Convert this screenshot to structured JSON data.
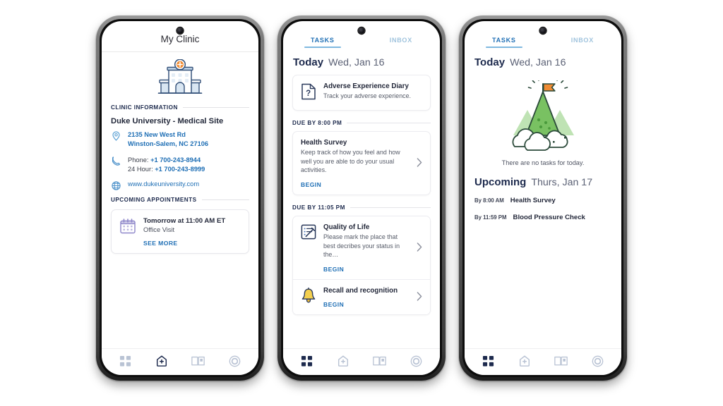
{
  "colors": {
    "brand_blue": "#1f6fb5",
    "navy": "#1d2a4d",
    "tab_inactive": "#9fc3dd",
    "accent_orange": "#e8792b",
    "green": "#6cbb5a",
    "calendar_purple": "#8d86c9",
    "bell_yellow": "#f0c83c"
  },
  "phone1": {
    "header_title": "My Clinic",
    "hospital_icon": "hospital-building-icon",
    "clinic_information_label": "CLINIC INFORMATION",
    "clinic_name": "Duke University - Medical Site",
    "address": {
      "icon": "location-pin-icon",
      "line1": "2135 New West Rd",
      "line2": "Winston-Salem, NC 27106"
    },
    "phone": {
      "icon": "phone-icon",
      "label1": "Phone: ",
      "number1": "+1 700-243-8944",
      "label2": "24 Hour: ",
      "number2": "+1 700-243-8999"
    },
    "website": {
      "icon": "globe-icon",
      "url": "www.dukeuniversity.com"
    },
    "upcoming_appointments_label": "UPCOMING APPOINTMENTS",
    "appointment": {
      "icon": "calendar-icon",
      "when": "Tomorrow at 11:00 AM ET",
      "type": "Office Visit",
      "see_more_label": "SEE MORE"
    },
    "bottom_nav": {
      "active": "clinic",
      "items": [
        {
          "id": "dashboard",
          "icon": "grid-dashboard-icon"
        },
        {
          "id": "clinic",
          "icon": "medical-bag-icon"
        },
        {
          "id": "library",
          "icon": "open-book-icon"
        },
        {
          "id": "profile",
          "icon": "ring-target-icon"
        }
      ]
    }
  },
  "phone2": {
    "tabs": [
      {
        "id": "tasks",
        "label": "TASKS",
        "active": true
      },
      {
        "id": "inbox",
        "label": "INBOX",
        "active": false
      }
    ],
    "today_label": "Today",
    "today_date": "Wed, Jan 16",
    "top_task": {
      "icon": "document-question-icon",
      "title": "Adverse Experience Diary",
      "desc": "Track your adverse experience."
    },
    "group1": {
      "due_label": "DUE BY 8:00 PM",
      "tasks": [
        {
          "icon": "",
          "title": "Health Survey",
          "desc": "Keep track of how you feel and how well you are able to do your usual activities.",
          "begin_label": "BEGIN",
          "chevron": "chevron-right-icon"
        }
      ]
    },
    "group2": {
      "due_label": "DUE BY 11:05 PM",
      "tasks": [
        {
          "icon": "checklist-pencil-icon",
          "title": "Quality of Life",
          "desc": "Please mark the place that best decribes your status in the…",
          "begin_label": "BEGIN",
          "chevron": "chevron-right-icon"
        },
        {
          "icon": "bell-icon",
          "title": "Recall and recognition",
          "desc": "",
          "begin_label": "BEGIN",
          "chevron": "chevron-right-icon"
        }
      ]
    },
    "bottom_nav": {
      "active": "dashboard",
      "items": [
        {
          "id": "dashboard",
          "icon": "grid-dashboard-icon"
        },
        {
          "id": "clinic",
          "icon": "medical-bag-icon"
        },
        {
          "id": "library",
          "icon": "open-book-icon"
        },
        {
          "id": "profile",
          "icon": "ring-target-icon"
        }
      ]
    }
  },
  "phone3": {
    "tabs": [
      {
        "id": "tasks",
        "label": "TASKS",
        "active": true
      },
      {
        "id": "inbox",
        "label": "INBOX",
        "active": false
      }
    ],
    "today_label": "Today",
    "today_date": "Wed, Jan 16",
    "empty_illustration": "mountain-flag-clouds-icon",
    "empty_message": "There are no tasks for today.",
    "upcoming_label": "Upcoming",
    "upcoming_date": "Thurs, Jan 17",
    "upcoming_items": [
      {
        "when": "By 8:00 AM",
        "title": "Health Survey"
      },
      {
        "when": "By 11:59 PM",
        "title": "Blood Pressure Check"
      }
    ],
    "bottom_nav": {
      "active": "dashboard",
      "items": [
        {
          "id": "dashboard",
          "icon": "grid-dashboard-icon"
        },
        {
          "id": "clinic",
          "icon": "medical-bag-icon"
        },
        {
          "id": "library",
          "icon": "open-book-icon"
        },
        {
          "id": "profile",
          "icon": "ring-target-icon"
        }
      ]
    }
  }
}
